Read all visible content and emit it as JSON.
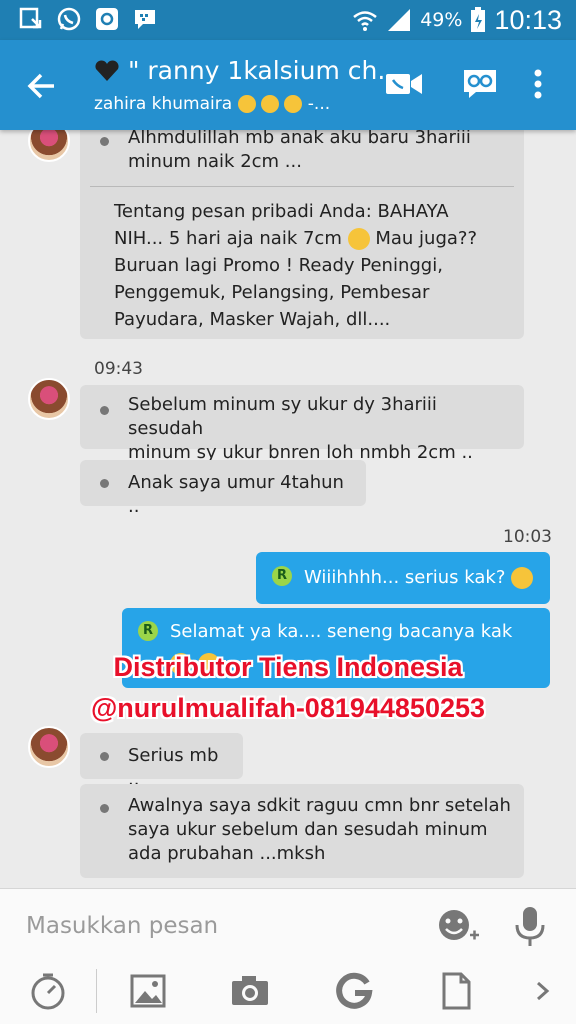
{
  "status_bar": {
    "battery_percent": "49%",
    "time": "10:13",
    "icons": [
      "download-icon",
      "whatsapp-icon",
      "instagram-icon",
      "bbm-icon",
      "wifi-icon",
      "signal-icon",
      "battery-icon"
    ]
  },
  "header": {
    "title": "\" ranny 1kalsium ch...",
    "subtitle": "zahira khumaira",
    "subtitle_suffix": "-..."
  },
  "messages": {
    "m1_line1": "Alhmdulillah mb anak aku baru 3hariii",
    "m1_line2": "minum naik 2cm ...",
    "m1_quote_l1": "Tentang pesan pribadi Anda: BAHAYA",
    "m1_quote_l2a": "NIH...  5 hari aja naik 7cm",
    "m1_quote_l2b": "Mau juga??",
    "m1_quote_l3": "Buruan lagi Promo ! Ready Peninggi,",
    "m1_quote_l4": "Penggemuk, Pelangsing, Pembesar",
    "m1_quote_l5": "Payudara, Masker Wajah, dll....",
    "time1": "09:43",
    "m2_line1": "Sebelum minum sy ukur dy 3hariii sesudah",
    "m2_line2": "minum sy ukur bnren loh nmbh 2cm ..",
    "m3": "Anak saya umur 4tahun ..",
    "time2": "10:03",
    "out1": "Wiiihhhh...  serius kak?",
    "out2": "Selamat ya ka....   seneng bacanya kak",
    "m4": "Serius mb ..",
    "m5_line1": "Awalnya saya sdkit raguu cmn bnr setelah",
    "m5_line2": "saya ukur sebelum dan sesudah minum",
    "m5_line3": "ada prubahan ...mksh"
  },
  "watermark": {
    "line1": "Distributor Tiens Indonesia",
    "line2": "@nurulmualifah-081944850253"
  },
  "composer": {
    "placeholder": "Masukkan pesan",
    "tools": [
      "timer-icon",
      "image-icon",
      "camera-icon",
      "google-icon",
      "file-icon",
      "chevron-right-icon"
    ]
  },
  "colors": {
    "status_bar": "#1f7fb3",
    "app_bar": "#2590cf",
    "bubble_in": "#dcdcdc",
    "bubble_out": "#27a4e8",
    "watermark": "#e8102a"
  }
}
